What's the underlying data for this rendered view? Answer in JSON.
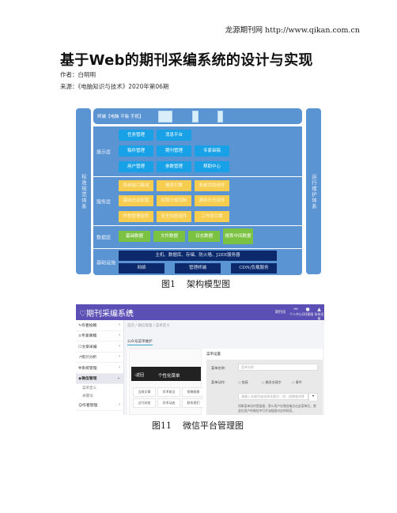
{
  "source_header": "龙源期刊网 http://www.qikan.com.cn",
  "title": "基于Web的期刊采编系统的设计与实现",
  "author": "作者：白明明",
  "source": "来源：《电脑知识与技术》2020年第06期",
  "figure1": {
    "left_column": "标准规范体系",
    "right_column": "运行维护体系",
    "terminal": {
      "label": "终端【电脑 平板 手机】",
      "devices": [
        "desktop-icon",
        "tablet-icon",
        "phone-icon"
      ]
    },
    "presentation_layer": {
      "label": "展示层",
      "rows": [
        [
          "任务管理",
          "消息平台"
        ],
        [
          "稿件管理",
          "期刊管理",
          "专家审稿"
        ],
        [
          "用户管理",
          "参数管理",
          "帮助中心"
        ]
      ]
    },
    "service_layer": {
      "label": "服务层",
      "rows": [
        [
          "系统接口集成",
          "报表引擎",
          "系统消息组件"
        ],
        [
          "基础信息配置",
          "权限分级控制",
          "通用日志组件"
        ],
        [
          "异常管理组件",
          "安全加密组件",
          "工作流引擎"
        ]
      ]
    },
    "data_layer": {
      "label": "数据层",
      "items": [
        "基础数据",
        "文件数据",
        "日志数据",
        "报表中间数据"
      ]
    },
    "infrastructure": {
      "label": "基础设施",
      "top": "主机、数据库、存储、防火墙、J2EE服务器",
      "bottom": [
        "网络",
        "管理终端",
        "CDN/负载服务"
      ]
    },
    "caption_num": "图1",
    "caption_text": "架构模型图",
    "colors": {
      "panel": "#5b94d3",
      "presentation": "#18a1e6",
      "service": "#f6cd4f",
      "data": "#7cc242",
      "infrastructure": "#0c2a6b"
    }
  },
  "figure2": {
    "app_title": "期刊采编系统",
    "topbar": {
      "user": "期刊员",
      "items": [
        "个人中心",
        "QQ客服",
        "系统设置"
      ]
    },
    "sidebar": {
      "items": [
        {
          "label": "作者投稿",
          "icon": "pencil-icon"
        },
        {
          "label": "专家审稿",
          "icon": "list-icon"
        },
        {
          "label": "文章采编",
          "icon": "edit-icon"
        },
        {
          "label": "统计分析",
          "icon": "chart-icon"
        },
        {
          "label": "系统管理",
          "icon": "wrench-icon"
        },
        {
          "label": "微信管理",
          "icon": "wechat-icon",
          "active": true
        },
        {
          "label": "作者管理",
          "icon": "user-icon"
        }
      ],
      "subitems": [
        "菜单定义",
        "关键词"
      ]
    },
    "breadcrumb": "首页 / 微信管理 / 菜单定义",
    "tab": "公众号菜单维护",
    "phone": {
      "back": "返回",
      "title": "个性化菜单",
      "menu": [
        "当前文章",
        "学术前沿",
        "投稿指南",
        "过刊浏览",
        "学术动态",
        "联系我们"
      ]
    },
    "settings": {
      "title": "菜单设置",
      "name_label": "菜单名称:",
      "name_placeholder": "菜单名称",
      "action_label": "菜单动作:",
      "radios": [
        "链接",
        "触发关键字",
        "事件"
      ],
      "keyword_placeholder": "请输入关键字或选择关键字，如：校稿查询等",
      "hint": "如果菜单动作是链接，那么用户在微信端点击此菜单后，就会在用户的微信中打开该链接对应的网页。"
    },
    "caption_num": "图11",
    "caption_text": "微信平台管理图",
    "colors": {
      "topbar": "#5b4eb4",
      "tab_underline": "#3aa0c9"
    }
  }
}
